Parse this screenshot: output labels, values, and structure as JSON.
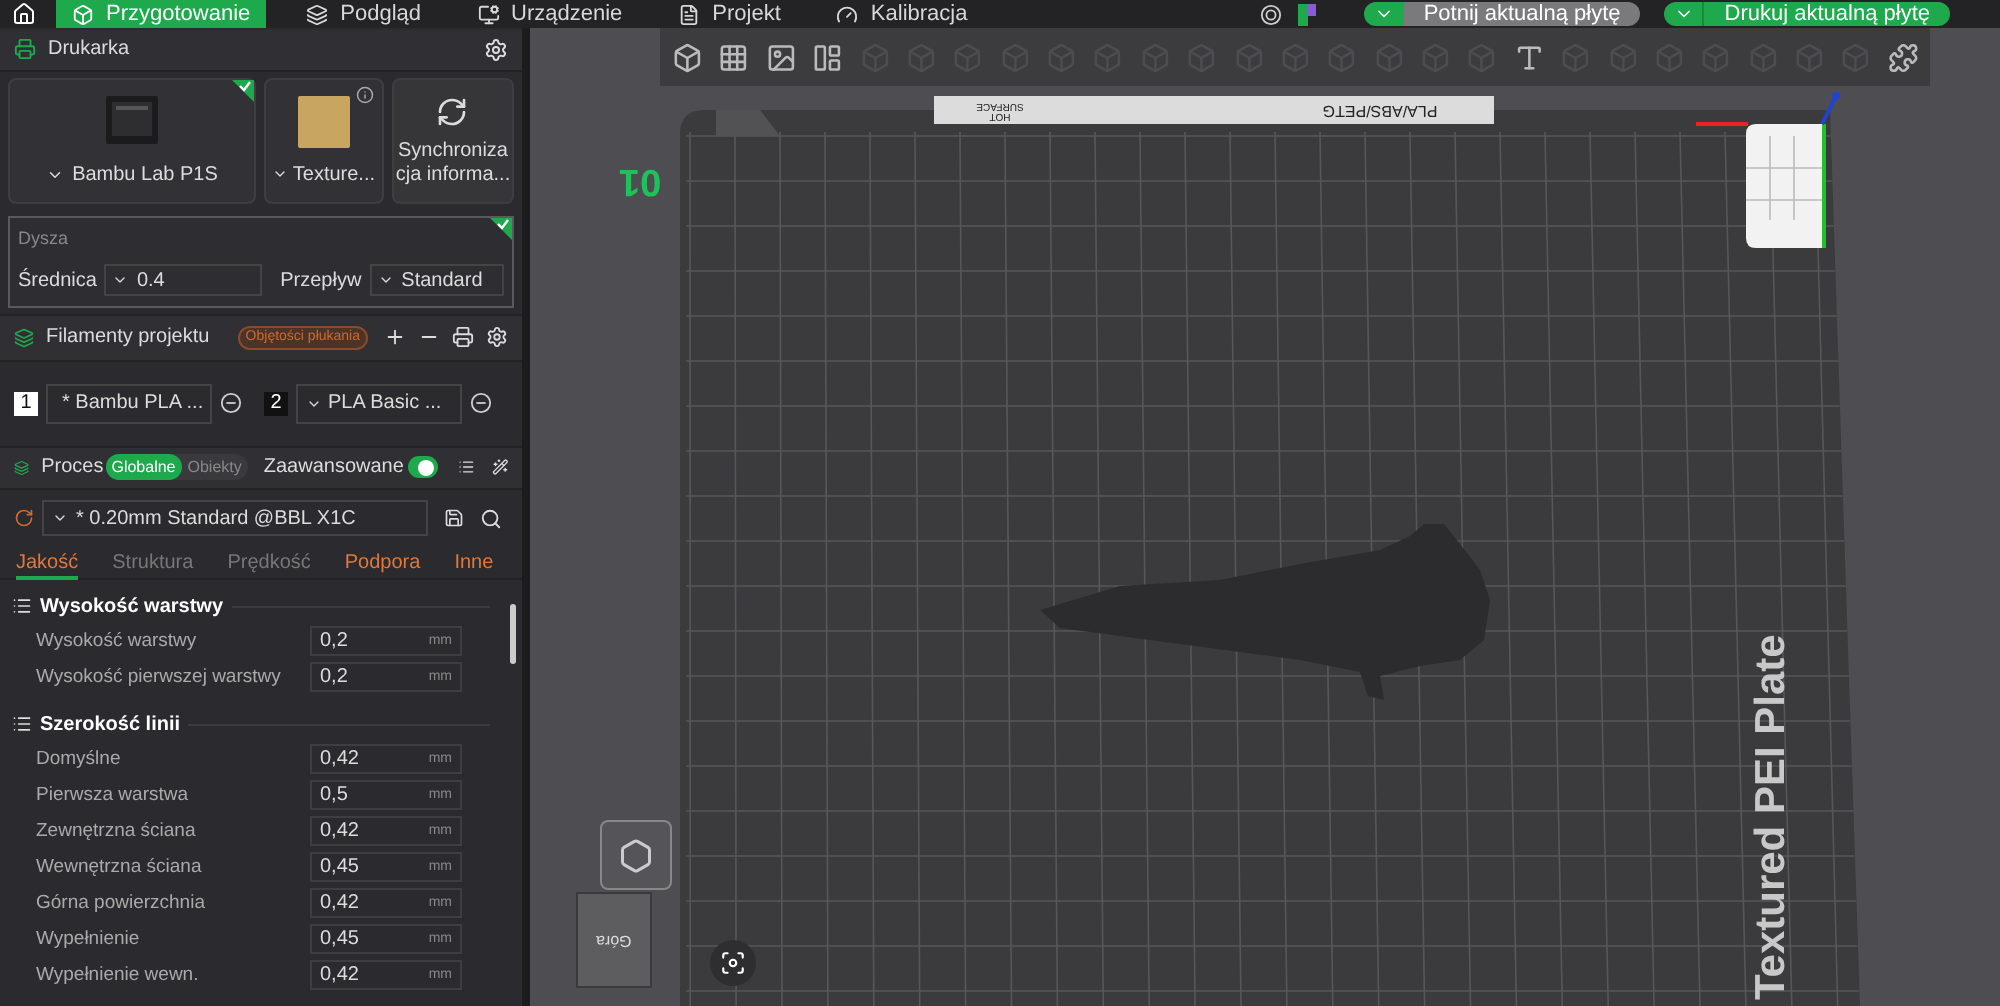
{
  "top_bar": {
    "tabs": [
      {
        "label": "Przygotowanie",
        "selected": true
      },
      {
        "label": "Podgląd",
        "selected": false
      },
      {
        "label": "Urządzenie",
        "selected": false
      },
      {
        "label": "Projekt",
        "selected": false
      },
      {
        "label": "Kalibracja",
        "selected": false
      }
    ],
    "slice_button": "Potnij aktualną płytę",
    "print_button": "Drukuj aktualną płytę"
  },
  "printer_panel": {
    "title": "Drukarka",
    "printer": "Bambu Lab P1S",
    "plate": "Texture...",
    "sync_lines": [
      "Synchroniza",
      "cja informa..."
    ]
  },
  "nozzle": {
    "title": "Dysza",
    "diameter_label": "Średnica",
    "diameter": "0.4",
    "flow_label": "Przepływ",
    "flow": "Standard"
  },
  "filaments": {
    "title": "Filamenty projektu",
    "badge": "Objętości płukania",
    "items": [
      {
        "index": "1",
        "name": "* Bambu PLA ...",
        "color": "#ffffff"
      },
      {
        "index": "2",
        "name": "PLA Basic ...",
        "color": "#111111"
      }
    ]
  },
  "process": {
    "title": "Proces",
    "scope": [
      {
        "label": "Globalne",
        "selected": true
      },
      {
        "label": "Obiekty",
        "selected": false
      }
    ],
    "advanced_label": "Zaawansowane",
    "advanced_on": true,
    "preset": "* 0.20mm Standard @BBL X1C",
    "tabs": [
      {
        "label": "Jakość",
        "selected": true,
        "modified": true
      },
      {
        "label": "Struktura",
        "selected": false,
        "modified": false
      },
      {
        "label": "Prędkość",
        "selected": false,
        "modified": false
      },
      {
        "label": "Podpora",
        "selected": false,
        "modified": true
      },
      {
        "label": "Inne",
        "selected": false,
        "modified": true
      }
    ]
  },
  "settings_groups": [
    {
      "title": "Wysokość warstwy",
      "rows": [
        {
          "label": "Wysokość warstwy",
          "value": "0,2",
          "unit": "mm"
        },
        {
          "label": "Wysokość pierwszej warstwy",
          "value": "0,2",
          "unit": "mm"
        }
      ]
    },
    {
      "title": "Szerokość linii",
      "rows": [
        {
          "label": "Domyślne",
          "value": "0,42",
          "unit": "mm"
        },
        {
          "label": "Pierwsza warstwa",
          "value": "0,5",
          "unit": "mm"
        },
        {
          "label": "Zewnętrzna ściana",
          "value": "0,42",
          "unit": "mm"
        },
        {
          "label": "Wewnętrzna ściana",
          "value": "0,45",
          "unit": "mm"
        },
        {
          "label": "Górna powierzchnia",
          "value": "0,42",
          "unit": "mm"
        },
        {
          "label": "Wypełnienie",
          "value": "0,45",
          "unit": "mm"
        },
        {
          "label": "Wypełnienie wewn.",
          "value": "0,42",
          "unit": "mm"
        }
      ]
    }
  ],
  "viewport": {
    "plate_number": "01",
    "bed_material": "PLA/ABS/PETG",
    "bed_warning": [
      "HOT",
      "SURFACE"
    ],
    "plate_name": "Textured PEI Plate",
    "view_cube_label": "Góra"
  }
}
